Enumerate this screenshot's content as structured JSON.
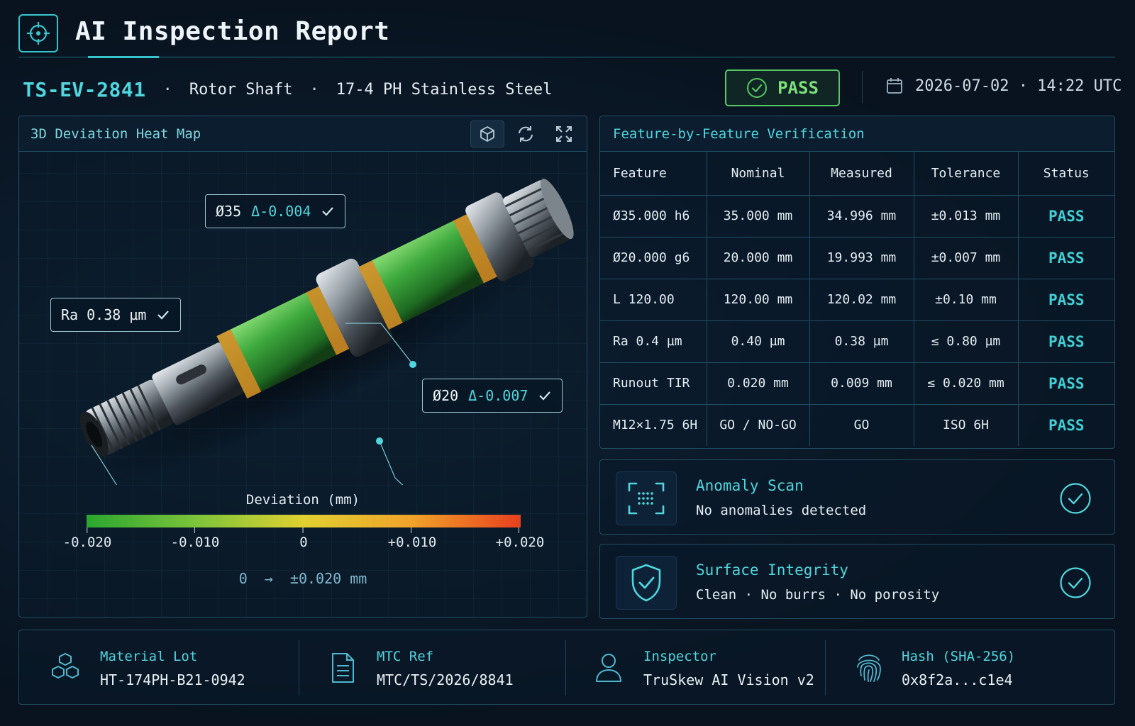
{
  "header": {
    "title": "AI Inspection Report"
  },
  "part": {
    "id": "TS-EV-2841",
    "name": "Rotor Shaft",
    "material": "17-4 PH Stainless Steel",
    "separator": "·",
    "status": "PASS",
    "datetime": "2026-07-02 · 14:22 UTC"
  },
  "heatmap": {
    "title": "3D Deviation Heat Map",
    "tools": [
      "cube-view-icon",
      "refresh-icon",
      "fullscreen-icon"
    ],
    "callouts": {
      "d35": {
        "label": "Ø35",
        "delta": "Δ-0.004"
      },
      "ra": {
        "label": "Ra 0.38 µm"
      },
      "d20": {
        "label": "Ø20",
        "delta": "Δ-0.007"
      }
    },
    "legend": {
      "title": "Deviation (mm)",
      "ticks": [
        "-0.020",
        "-0.010",
        "0",
        "+0.010",
        "+0.020"
      ],
      "colors": [
        "#2aa630",
        "#7cc43a",
        "#e0d030",
        "#f0a22a",
        "#e8401e"
      ]
    },
    "range": "0  →  ±0.020 mm"
  },
  "verification": {
    "title": "Feature-by-Feature Verification",
    "columns": [
      "Feature",
      "Nominal",
      "Measured",
      "Tolerance",
      "Status"
    ],
    "rows": [
      [
        "Ø35.000 h6",
        "35.000 mm",
        "34.996 mm",
        "±0.013 mm",
        "PASS"
      ],
      [
        "Ø20.000 g6",
        "20.000 mm",
        "19.993 mm",
        "±0.007 mm",
        "PASS"
      ],
      [
        "L 120.00",
        "120.00 mm",
        "120.02 mm",
        "±0.10 mm",
        "PASS"
      ],
      [
        "Ra 0.4 µm",
        "0.40 µm",
        "0.38 µm",
        "≤ 0.80 µm",
        "PASS"
      ],
      [
        "Runout TIR",
        "0.020 mm",
        "0.009 mm",
        "≤ 0.020 mm",
        "PASS"
      ],
      [
        "M12×1.75 6H",
        "GO / NO-GO",
        "GO",
        "ISO 6H",
        "PASS"
      ]
    ]
  },
  "checks": {
    "anomaly": {
      "title": "Anomaly Scan",
      "detail": "No anomalies detected",
      "icon": "scan-icon"
    },
    "surface": {
      "title": "Surface Integrity",
      "detail": "Clean · No burrs · No porosity",
      "icon": "shield-check-icon"
    }
  },
  "footer": {
    "material_lot": {
      "label": "Material Lot",
      "value": "HT-174PH-B21-0942",
      "icon": "cubes-icon"
    },
    "mtc_ref": {
      "label": "MTC Ref",
      "value": "MTC/TS/2026/8841",
      "icon": "document-icon"
    },
    "inspector": {
      "label": "Inspector",
      "value": "TruSkew AI Vision v2",
      "icon": "user-icon"
    },
    "hash": {
      "label": "Hash (SHA-256)",
      "value": "0x8f2a...c1e4",
      "icon": "fingerprint-icon"
    }
  },
  "colors": {
    "accent": "#4fd6de",
    "pass_green": "#57c563",
    "background": "#0a1624"
  }
}
